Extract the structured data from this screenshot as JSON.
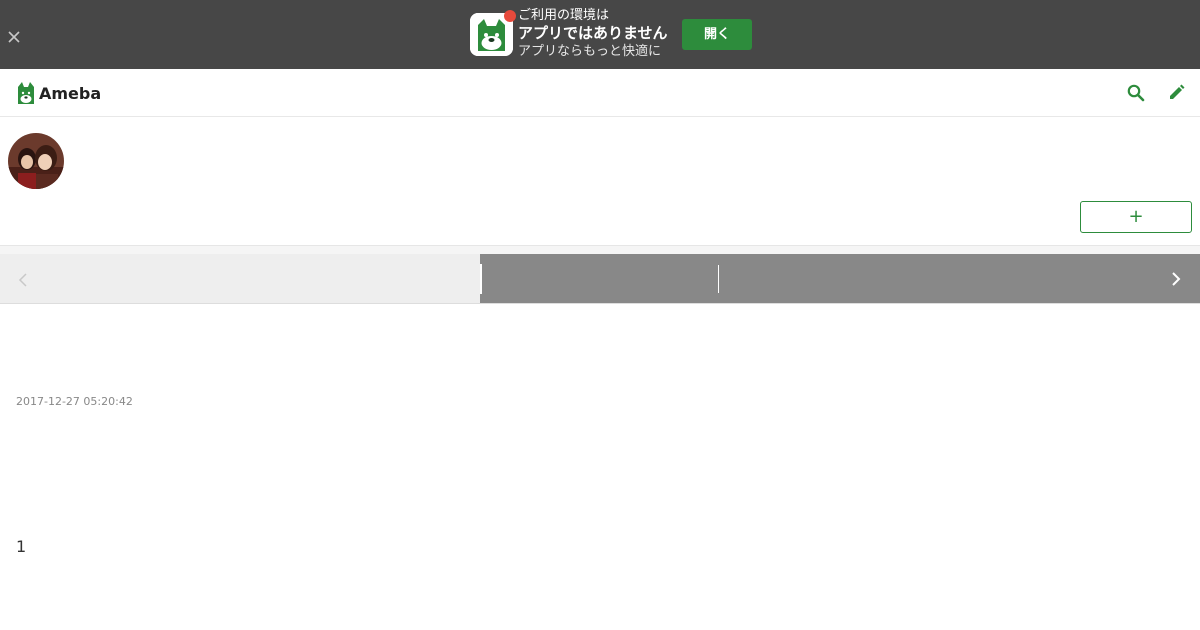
{
  "app_banner": {
    "line1": "ご利用の環境は",
    "line2": "アプリではありません",
    "line3": "アプリならもっと快適に",
    "open_label": "開く",
    "close_icon": "close-icon",
    "app_icon": "ameba-app-icon",
    "background_color": "#474747",
    "button_color": "#2d8c3c",
    "badge_color": "#e84a3c"
  },
  "header": {
    "logo_text": "Ameba",
    "search_icon": "search-icon",
    "edit_icon": "pencil-icon",
    "accent_color": "#2d8c3c"
  },
  "profile": {
    "blog_title": "",
    "follow_label": "+",
    "avatar": "avatar-photo"
  },
  "pager": {
    "prev_icon": "chevron-left-icon",
    "next_icon": "chevron-right-icon"
  },
  "post": {
    "date": "2017-12-27 05:20:42",
    "body": "1"
  }
}
